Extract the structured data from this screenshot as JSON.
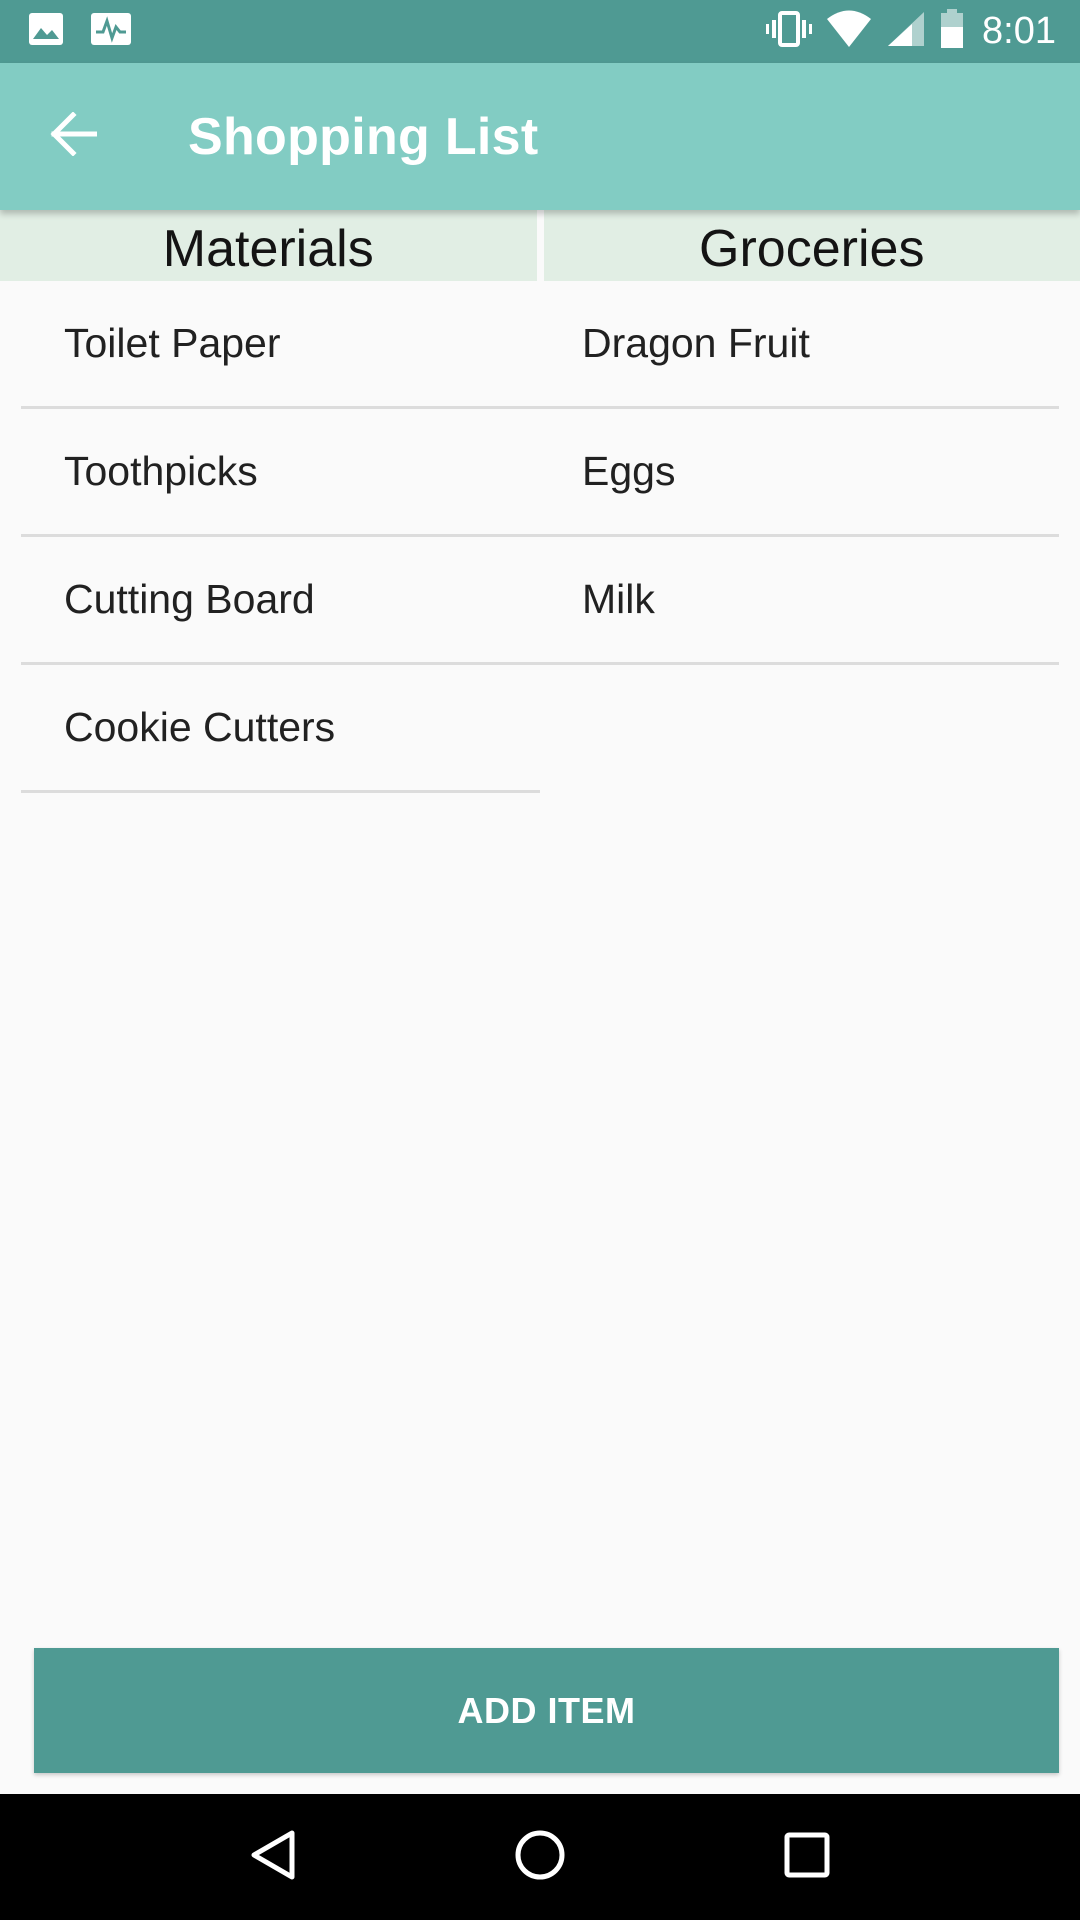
{
  "status_bar": {
    "time": "8:01",
    "left_icons": [
      "image-icon",
      "activity-icon"
    ],
    "right_icons": [
      "vibrate-icon",
      "wifi-icon",
      "signal-icon",
      "battery-icon"
    ]
  },
  "app_bar": {
    "title": "Shopping List",
    "back_icon": "arrow-back-icon"
  },
  "columns": [
    {
      "header": "Materials",
      "items": [
        "Toilet Paper",
        "Toothpicks",
        "Cutting Board",
        "Cookie Cutters"
      ]
    },
    {
      "header": "Groceries",
      "items": [
        "Dragon Fruit",
        "Eggs",
        "Milk"
      ]
    }
  ],
  "add_button": {
    "label": "ADD ITEM"
  },
  "nav_bar": {
    "icons": [
      "back-triangle-icon",
      "home-circle-icon",
      "recents-square-icon"
    ]
  },
  "colors": {
    "status_bar": "#4f9a93",
    "app_bar": "#82ccc3",
    "header_bg": "#e1eee4",
    "button": "#4f9a93"
  }
}
